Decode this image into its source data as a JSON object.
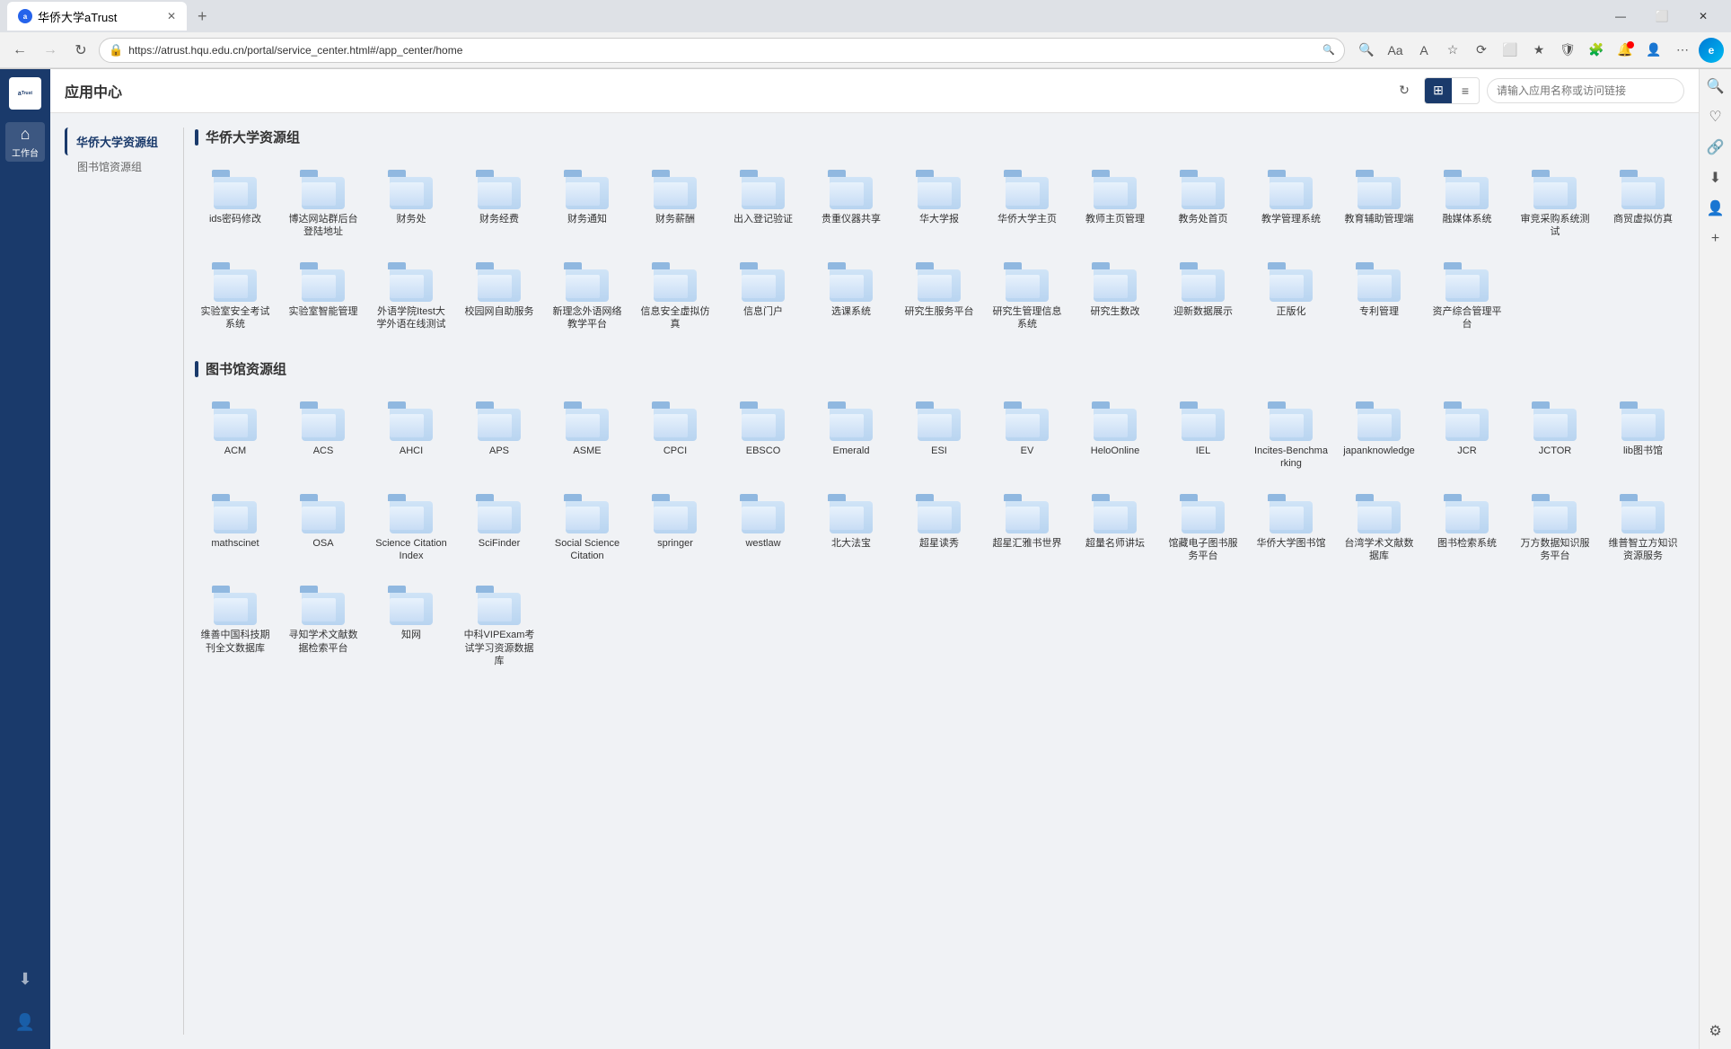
{
  "browser": {
    "tab_title": "华侨大学aTrust",
    "url": "https://atrust.hqu.edu.cn/portal/service_center.html#/app_center/home",
    "new_tab_label": "+",
    "nav": {
      "back_icon": "←",
      "forward_icon": "→",
      "refresh_icon": "↻",
      "home_icon": "⌂"
    },
    "toolbar_icons": [
      "🔍",
      "Aa",
      "A",
      "☆",
      "⟳",
      "⬜",
      "★",
      "🛡",
      "🧩",
      "🔔",
      "⚙",
      "⋯"
    ],
    "edge_icon": "e",
    "window_controls": [
      "—",
      "⬜",
      "✕"
    ],
    "right_sidebar_icons": [
      "🔍",
      "♡",
      "🔗",
      "⬇",
      "👤",
      "⚙"
    ]
  },
  "app": {
    "title": "应用中心",
    "header": {
      "refresh_label": "↻",
      "view_grid_label": "⊞",
      "view_list_label": "≡",
      "search_placeholder": "请输入应用名称或访问链接"
    },
    "left_nav": {
      "groups": [
        {
          "id": "huaqiao",
          "label": "华侨大学资源组",
          "active": true
        },
        {
          "id": "library",
          "label": "图书馆资源组",
          "active": false
        }
      ]
    },
    "sidebar": {
      "logo_text": "aTrust",
      "items": [
        {
          "id": "home",
          "icon": "⌂",
          "label": "工作台",
          "active": true
        }
      ],
      "bottom_items": [
        {
          "id": "download",
          "icon": "⬇",
          "label": ""
        },
        {
          "id": "user",
          "icon": "👤",
          "label": ""
        },
        {
          "id": "settings",
          "icon": "⚙",
          "label": ""
        }
      ]
    },
    "sections": [
      {
        "id": "huaqiao-section",
        "title": "华侨大学资源组",
        "apps": [
          {
            "id": "ids",
            "label": "ids密码修改"
          },
          {
            "id": "boda",
            "label": "博达网站群后台登陆地址"
          },
          {
            "id": "caiwuchu",
            "label": "财务处"
          },
          {
            "id": "caiwujingfei",
            "label": "财务经费"
          },
          {
            "id": "caiwutongzhi",
            "label": "财务通知"
          },
          {
            "id": "caiwuxinchou",
            "label": "财务薪酬"
          },
          {
            "id": "churu",
            "label": "出入登记验证"
          },
          {
            "id": "guizhong",
            "label": "贵重仪器共享"
          },
          {
            "id": "huadaxuebao",
            "label": "华大学报"
          },
          {
            "id": "huaqiaozhuye",
            "label": "华侨大学主页"
          },
          {
            "id": "jiaoshi",
            "label": "教师主页管理"
          },
          {
            "id": "jiaowuchu",
            "label": "教务处首页"
          },
          {
            "id": "jiaoxue",
            "label": "教学管理系统"
          },
          {
            "id": "jiaoyufuzhu",
            "label": "教育辅助管理端"
          },
          {
            "id": "rongmeiti",
            "label": "融媒体系统"
          },
          {
            "id": "caigou",
            "label": "审竞采购系统测试"
          },
          {
            "id": "shangmao",
            "label": "商贸虚拟仿真"
          },
          {
            "id": "shiyanshi",
            "label": "实验室安全考试系统"
          },
          {
            "id": "shiyanshizhineng",
            "label": "实验室智能管理"
          },
          {
            "id": "waiyu",
            "label": "外语学院Itest大学外语在线测试"
          },
          {
            "id": "xiaoyuan",
            "label": "校园网自助服务"
          },
          {
            "id": "xinlinian",
            "label": "新理念外语网络教学平台"
          },
          {
            "id": "xinxi",
            "label": "信息安全虚拟仿真"
          },
          {
            "id": "xinximen",
            "label": "信息门户"
          },
          {
            "id": "xuanke",
            "label": "选课系统"
          },
          {
            "id": "yanjiusheng",
            "label": "研究生服务平台"
          },
          {
            "id": "yanjiushengguanli",
            "label": "研究生管理信息系统"
          },
          {
            "id": "yanjiushengjiaofu",
            "label": "研究生数改"
          },
          {
            "id": "yingxin",
            "label": "迎新数据展示"
          },
          {
            "id": "zhengbanhua",
            "label": "正版化"
          },
          {
            "id": "zhuanli",
            "label": "专利管理"
          },
          {
            "id": "zichan",
            "label": "资产综合管理平台"
          }
        ]
      },
      {
        "id": "library-section",
        "title": "图书馆资源组",
        "apps": [
          {
            "id": "acm",
            "label": "ACM"
          },
          {
            "id": "acs",
            "label": "ACS"
          },
          {
            "id": "ahci",
            "label": "AHCI"
          },
          {
            "id": "aps",
            "label": "APS"
          },
          {
            "id": "asme",
            "label": "ASME"
          },
          {
            "id": "cpci",
            "label": "CPCI"
          },
          {
            "id": "ebsco",
            "label": "EBSCO"
          },
          {
            "id": "emerald",
            "label": "Emerald"
          },
          {
            "id": "esi",
            "label": "ESI"
          },
          {
            "id": "ev",
            "label": "EV"
          },
          {
            "id": "helionline",
            "label": "HeloOnline"
          },
          {
            "id": "iel",
            "label": "IEL"
          },
          {
            "id": "incites",
            "label": "Incites-Benchmarking"
          },
          {
            "id": "japanknowledge",
            "label": "japanknowledge"
          },
          {
            "id": "jcr",
            "label": "JCR"
          },
          {
            "id": "jctor",
            "label": "JCTOR"
          },
          {
            "id": "lib",
            "label": "lib图书馆"
          },
          {
            "id": "mathscinet",
            "label": "mathscinet"
          },
          {
            "id": "osa",
            "label": "OSA"
          },
          {
            "id": "sciencecitation",
            "label": "Science Citation Index"
          },
          {
            "id": "scifinder",
            "label": "SciFinder"
          },
          {
            "id": "socialsciencecitation",
            "label": "Social Science Citation"
          },
          {
            "id": "springer",
            "label": "springer"
          },
          {
            "id": "westlaw",
            "label": "westlaw"
          },
          {
            "id": "beida",
            "label": "北大法宝"
          },
          {
            "id": "chaoxing",
            "label": "超星读秀"
          },
          {
            "id": "chaoxinghuihui",
            "label": "超星汇雅书世界"
          },
          {
            "id": "chaoxingming",
            "label": "超量名师讲坛"
          },
          {
            "id": "guancang",
            "label": "馆藏电子图书服务平台"
          },
          {
            "id": "huaqiaotushuguan",
            "label": "华侨大学图书馆"
          },
          {
            "id": "taiwan",
            "label": "台湾学术文献数据库"
          },
          {
            "id": "tushuguan",
            "label": "图书检索系统"
          },
          {
            "id": "wanfang",
            "label": "万方数据知识服务平台"
          },
          {
            "id": "weipufanyi",
            "label": "维普智立方知识资源服务"
          },
          {
            "id": "weipu",
            "label": "维善中国科技期刊全文数据库"
          },
          {
            "id": "xueshu",
            "label": "寻知学术文献数据检索平台"
          },
          {
            "id": "zhiwang",
            "label": "知网"
          },
          {
            "id": "zhongke",
            "label": "中科VIPExam考试学习资源数据库"
          }
        ]
      }
    ]
  }
}
